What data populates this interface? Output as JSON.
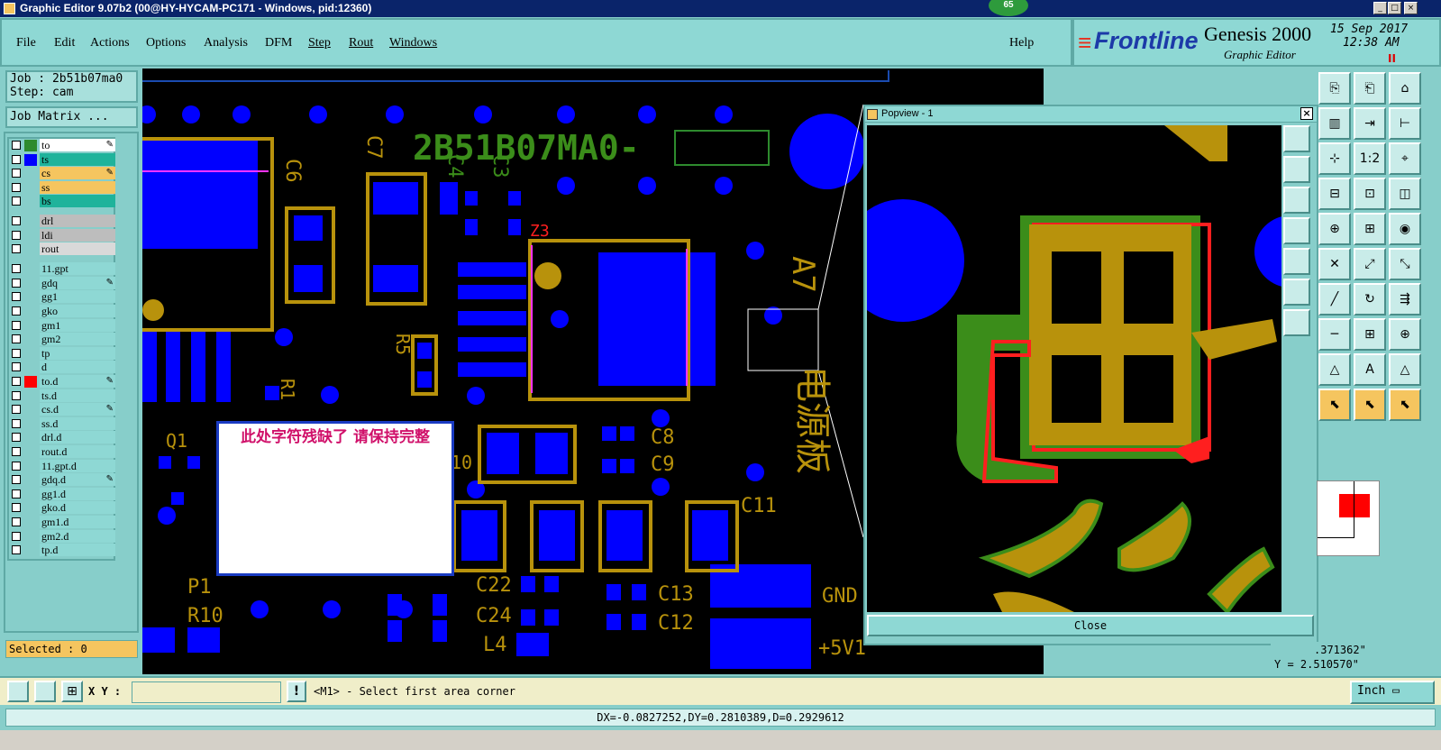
{
  "window": {
    "title": "Graphic Editor 9.07b2 (00@HY-HYCAM-PC171 - Windows, pid:12360)",
    "badge": "65"
  },
  "menu": {
    "items": [
      "File",
      "Edit",
      "Actions",
      "Options",
      "Analysis",
      "DFM",
      "Step",
      "Rout",
      "Windows"
    ],
    "help": "Help"
  },
  "brand": {
    "logo": "Frontline",
    "product": "Genesis 2000",
    "subtitle": "Graphic Editor",
    "date": "15 Sep 2017",
    "time": "12:38 AM"
  },
  "job": {
    "job_label": "Job : 2b51b07ma0",
    "step_label": "Step: cam",
    "matrix_button": "Job Matrix ..."
  },
  "layers": [
    {
      "name": "to",
      "color": "#ffffff",
      "swatch": "#2e8b2e",
      "mark": true
    },
    {
      "name": "ts",
      "color": "#1fb39b",
      "swatch": "#0000ff",
      "mark": false
    },
    {
      "name": "cs",
      "color": "#f5c55f",
      "swatch": "",
      "mark": true
    },
    {
      "name": "ss",
      "color": "#f5c55f",
      "swatch": "",
      "mark": false
    },
    {
      "name": "bs",
      "color": "#1fb39b",
      "swatch": "",
      "mark": false
    },
    {
      "name": "drl",
      "color": "#bdbdbd",
      "swatch": "",
      "mark": false
    },
    {
      "name": "ldi",
      "color": "#bdbdbd",
      "swatch": "",
      "mark": false
    },
    {
      "name": "rout",
      "color": "#d9d9d9",
      "swatch": "",
      "mark": false
    },
    {
      "name": "11.gpt",
      "color": "#8ed8d4",
      "swatch": "",
      "mark": false
    },
    {
      "name": "gdq",
      "color": "#8ed8d4",
      "swatch": "",
      "mark": true
    },
    {
      "name": "gg1",
      "color": "#8ed8d4",
      "swatch": "",
      "mark": false
    },
    {
      "name": "gko",
      "color": "#8ed8d4",
      "swatch": "",
      "mark": false
    },
    {
      "name": "gm1",
      "color": "#8ed8d4",
      "swatch": "",
      "mark": false
    },
    {
      "name": "gm2",
      "color": "#8ed8d4",
      "swatch": "",
      "mark": false
    },
    {
      "name": "tp",
      "color": "#8ed8d4",
      "swatch": "",
      "mark": false
    },
    {
      "name": "d",
      "color": "#8ed8d4",
      "swatch": "",
      "mark": false
    },
    {
      "name": "to.d",
      "color": "#8ed8d4",
      "swatch": "#ff0000",
      "mark": true
    },
    {
      "name": "ts.d",
      "color": "#8ed8d4",
      "swatch": "",
      "mark": false
    },
    {
      "name": "cs.d",
      "color": "#8ed8d4",
      "swatch": "",
      "mark": true
    },
    {
      "name": "ss.d",
      "color": "#8ed8d4",
      "swatch": "",
      "mark": false
    },
    {
      "name": "drl.d",
      "color": "#8ed8d4",
      "swatch": "",
      "mark": false
    },
    {
      "name": "rout.d",
      "color": "#8ed8d4",
      "swatch": "",
      "mark": false
    },
    {
      "name": "11.gpt.d",
      "color": "#8ed8d4",
      "swatch": "",
      "mark": false
    },
    {
      "name": "gdq.d",
      "color": "#8ed8d4",
      "swatch": "",
      "mark": true
    },
    {
      "name": "gg1.d",
      "color": "#8ed8d4",
      "swatch": "",
      "mark": false
    },
    {
      "name": "gko.d",
      "color": "#8ed8d4",
      "swatch": "",
      "mark": false
    },
    {
      "name": "gm1.d",
      "color": "#8ed8d4",
      "swatch": "",
      "mark": false
    },
    {
      "name": "gm2.d",
      "color": "#8ed8d4",
      "swatch": "",
      "mark": false
    },
    {
      "name": "tp.d",
      "color": "#8ed8d4",
      "swatch": "",
      "mark": false
    }
  ],
  "selected": "Selected : 0",
  "board": {
    "marking": "2B51B07MA0-",
    "labels": [
      "C6",
      "C7",
      "C4",
      "C3",
      "Z3",
      "R5",
      "R1",
      "Q1",
      "C8",
      "C9",
      "C11",
      "C22",
      "C24",
      "C13",
      "C12",
      "L4",
      "P1",
      "R10",
      "GND",
      "+5V1",
      "A7",
      "电源板",
      "10"
    ]
  },
  "annotation": "此处字符残缺了 请保持完整",
  "popview": {
    "title": "Popview - 1",
    "close_button": "Close"
  },
  "coords": {
    "x": ".371362\"",
    "y": "Y = 2.510570\""
  },
  "status": {
    "xy_label": "X Y :",
    "xy_value": "",
    "prompt": "<M1> - Select first area corner",
    "units": "Inch",
    "measure": "DX=-0.0827252,DY=0.2810389,D=0.2929612"
  }
}
